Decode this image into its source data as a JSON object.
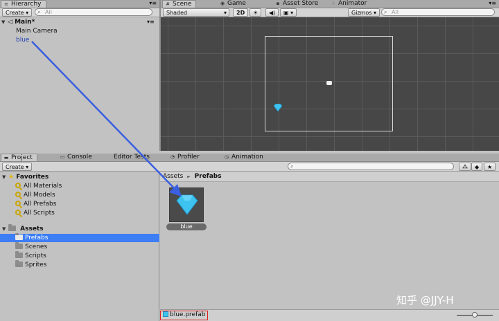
{
  "hierarchy": {
    "tab": "Hierarchy",
    "create": "Create",
    "search_placeholder": "All",
    "scene_name": "Main*",
    "items": [
      "Main Camera",
      "blue"
    ]
  },
  "scene_tabs": [
    "Scene",
    "Game",
    "Asset Store",
    "Animator"
  ],
  "scene_toolbar": {
    "shading": "Shaded",
    "mode_2d": "2D",
    "gizmos": "Gizmos",
    "search_placeholder": "All"
  },
  "project_tabs": [
    "Project",
    "Console",
    "Editor Tests",
    "Profiler",
    "Animation"
  ],
  "project": {
    "create": "Create",
    "favorites_label": "Favorites",
    "favorites": [
      "All Materials",
      "All Models",
      "All Prefabs",
      "All Scripts"
    ],
    "assets_label": "Assets",
    "folders": [
      "Prefabs",
      "Scenes",
      "Scripts",
      "Sprites"
    ],
    "selected_folder": "Prefabs"
  },
  "breadcrumb": {
    "root": "Assets",
    "sep": "►",
    "current": "Prefabs"
  },
  "asset_tile": {
    "label": "blue"
  },
  "status_file": "blue.prefab",
  "watermark": "知乎 @JJY-H",
  "colors": {
    "accent_selected": "#3d7ef5",
    "gem": "#3ec3f0",
    "arrow": "#3a5fe0",
    "highlight_box": "#e02020",
    "scene_bg": "#474747"
  }
}
